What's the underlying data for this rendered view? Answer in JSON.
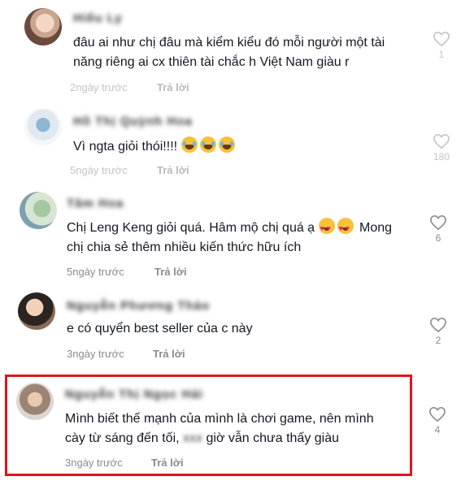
{
  "reply_label": "Trả lời",
  "highlight_color": "#e0141e",
  "comments": [
    {
      "username": "Hiếu Ly",
      "text_lines": [
        "đâu ai như chị đâu mà kiểm kiểu đó mỗi người một tài",
        "năng riêng ai cx thiên tài chắc h Việt Nam giàu r"
      ],
      "time": "2ngày trước",
      "likes": "1",
      "emojis": []
    },
    {
      "username": "Hồ Thị Quỳnh Hoa",
      "text_lines": [
        "Vì ngta giỏi thói!!!!"
      ],
      "time": "5ngày trước",
      "likes": "180",
      "emojis": [
        "laugh",
        "laugh",
        "laugh"
      ]
    },
    {
      "username": "Tâm Hoa",
      "text_lines": [
        "Chị Leng Keng giỏi quá. Hâm mộ chị quá ạ",
        "Mong",
        "chị chia sẻ thêm nhiều kiến thức hữu ích"
      ],
      "time": "5ngày trước",
      "likes": "6",
      "emojis": [
        "love",
        "love"
      ]
    },
    {
      "username": "Nguyễn Phương Thảo",
      "text_lines": [
        "e có quyển best seller của c này"
      ],
      "time": "3ngày trước",
      "likes": "2",
      "emojis": []
    },
    {
      "username": "Nguyễn Thị Ngọc Hải",
      "text_lines": [
        "Mình biết thế mạnh của mình là chơi game, nên mình",
        "cày từ sáng đến tối,",
        "giờ vẫn chưa thấy giàu"
      ],
      "censored_word": "xxx",
      "time": "3ngày trước",
      "likes": "4",
      "emojis": []
    }
  ]
}
